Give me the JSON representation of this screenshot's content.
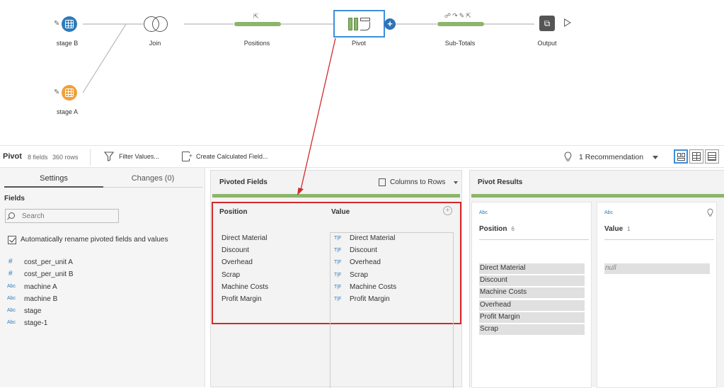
{
  "flow": {
    "nodes": {
      "stage_b": "stage B",
      "stage_a": "stage A",
      "join": "Join",
      "positions": "Positions",
      "pivot": "Pivot",
      "subtotals": "Sub-Totals",
      "output": "Output"
    },
    "colors": {
      "input_node": "#2e7ab8",
      "input_node_alt": "#f0a03c",
      "step_bar": "#8cb56a",
      "selection": "#3d8fdc",
      "annotation": "#d42a2a"
    }
  },
  "toolbar": {
    "title": "Pivot",
    "field_count": "8 fields",
    "row_count": "360 rows",
    "filter_label": "Filter Values...",
    "calc_label": "Create Calculated Field...",
    "recommendation_label": "1 Recommendation"
  },
  "settings": {
    "tabs": [
      "Settings",
      "Changes (0)"
    ],
    "fields_heading": "Fields",
    "search_placeholder": "Search",
    "auto_rename_label": "Automatically rename pivoted fields and values",
    "auto_rename_checked": true,
    "fields": [
      {
        "type": "#",
        "name": "cost_per_unit A"
      },
      {
        "type": "#",
        "name": "cost_per_unit B"
      },
      {
        "type": "Abc",
        "name": "machine A"
      },
      {
        "type": "Abc",
        "name": "machine B"
      },
      {
        "type": "Abc",
        "name": "stage"
      },
      {
        "type": "Abc",
        "name": "stage-1"
      }
    ]
  },
  "pivoted_fields": {
    "title": "Pivoted Fields",
    "mode": "Columns to Rows",
    "position_header": "Position",
    "value_header": "Value",
    "positions": [
      "Direct Material",
      "Discount",
      "Overhead",
      "Scrap",
      "Machine Costs",
      "Profit Margin"
    ],
    "value_type": "T|F",
    "values": [
      "Direct Material",
      "Discount",
      "Overhead",
      "Scrap",
      "Machine Costs",
      "Profit Margin"
    ]
  },
  "pivot_results": {
    "title": "Pivot Results",
    "position_card": {
      "type": "Abc",
      "name": "Position",
      "count": "6",
      "values": [
        "Direct Material",
        "Discount",
        "Machine Costs",
        "Overhead",
        "Profit Margin",
        "Scrap"
      ]
    },
    "value_card": {
      "type": "Abc",
      "name": "Value",
      "count": "1",
      "values": [
        "null"
      ]
    }
  }
}
